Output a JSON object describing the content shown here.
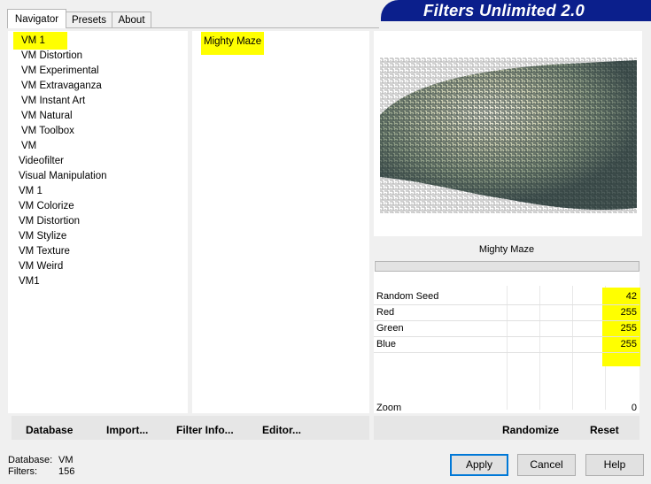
{
  "tabs": [
    {
      "label": "Navigator",
      "active": true
    },
    {
      "label": "Presets",
      "active": false
    },
    {
      "label": "About",
      "active": false
    }
  ],
  "banner_title": "Filters Unlimited 2.0",
  "categories": [
    {
      "label": "VM 1",
      "indent": true,
      "highlight": true
    },
    {
      "label": "VM Distortion",
      "indent": true
    },
    {
      "label": "VM Experimental",
      "indent": true
    },
    {
      "label": "VM Extravaganza",
      "indent": true
    },
    {
      "label": "VM Instant Art",
      "indent": true
    },
    {
      "label": "VM Natural",
      "indent": true
    },
    {
      "label": "VM Toolbox",
      "indent": true
    },
    {
      "label": "VM",
      "indent": true
    },
    {
      "label": "Videofilter",
      "indent": false
    },
    {
      "label": "Visual Manipulation",
      "indent": false
    },
    {
      "label": "VM 1",
      "indent": false
    },
    {
      "label": "VM Colorize",
      "indent": false
    },
    {
      "label": "VM Distortion",
      "indent": false
    },
    {
      "label": "VM Stylize",
      "indent": false
    },
    {
      "label": "VM Texture",
      "indent": false
    },
    {
      "label": "VM Weird",
      "indent": false
    },
    {
      "label": "VM1",
      "indent": false
    }
  ],
  "filters": [
    "Mighty Maze"
  ],
  "filter_name": "Mighty Maze",
  "params": [
    {
      "label": "Random Seed",
      "value": "42"
    },
    {
      "label": "Red",
      "value": "255"
    },
    {
      "label": "Green",
      "value": "255"
    },
    {
      "label": "Blue",
      "value": "255"
    }
  ],
  "zoom": {
    "label": "Zoom",
    "value": "0"
  },
  "left_buttons": {
    "database": "Database",
    "import": "Import...",
    "filter_info": "Filter Info...",
    "editor": "Editor..."
  },
  "right_buttons": {
    "randomize": "Randomize",
    "reset": "Reset"
  },
  "status": {
    "database_label": "Database:",
    "database_value": "VM",
    "filters_label": "Filters:",
    "filters_value": "156"
  },
  "dialog_buttons": {
    "apply": "Apply",
    "cancel": "Cancel",
    "help": "Help"
  },
  "colors": {
    "highlight": "#ffff00",
    "banner": "#0b1f8c"
  }
}
